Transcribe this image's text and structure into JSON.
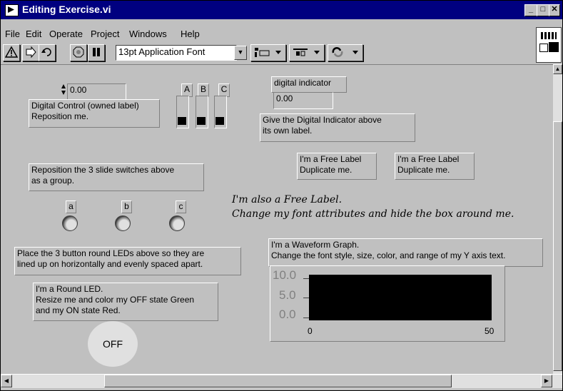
{
  "window": {
    "title": "Editing Exercise.vi"
  },
  "menu": [
    "File",
    "Edit",
    "Operate",
    "Project",
    "Windows",
    "Help"
  ],
  "toolbar": {
    "font": "13pt Application Font"
  },
  "panel": {
    "digital_control": {
      "value": "0.00",
      "label": "Digital Control (owned label)\nReposition me."
    },
    "switches": [
      "A",
      "B",
      "C"
    ],
    "digital_indicator": {
      "label": "digital indicator",
      "value": "0.00",
      "note": "Give the Digital Indicator above\nits own label."
    },
    "free_label_1": "I'm a Free Label\nDuplicate me.",
    "free_label_2": "I'm a Free Label\nDuplicate me.",
    "reposition_switches": "Reposition the 3 slide switches above\nas a group.",
    "leds": [
      "a",
      "b",
      "c"
    ],
    "free_label_italic": "I'm also a Free Label.\nChange my font attributes and hide the box around me.",
    "place_leds": "Place the 3 button round LEDs above so they are\nlined up on horizontally and evenly spaced apart.",
    "round_led_note": "I'm a Round LED.\nResize me and color my OFF state Green\nand my ON state Red.",
    "round_led_text": "OFF",
    "graph": {
      "note": "I'm a Waveform Graph.\nChange the font style, size, color, and range of my Y axis text.",
      "y_ticks": [
        "10.0",
        "5.0",
        "0.0"
      ],
      "x_ticks": [
        "0",
        "50"
      ]
    }
  }
}
